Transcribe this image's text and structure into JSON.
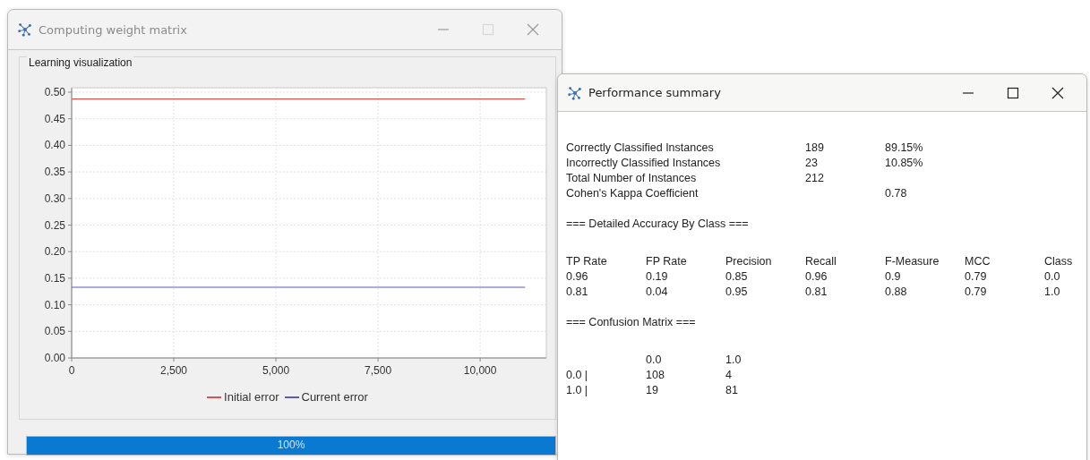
{
  "training_window": {
    "title": "Computing weight matrix",
    "active": false,
    "group_title": "Learning visualization",
    "chart_data": {
      "type": "line",
      "grid": true,
      "x": [
        0,
        11100
      ],
      "xlim": [
        0,
        11620
      ],
      "ylim": [
        0,
        0.5
      ],
      "xticks": [
        {
          "value": 0,
          "label": "0"
        },
        {
          "value": 2500,
          "label": "2,500"
        },
        {
          "value": 5000,
          "label": "5,000"
        },
        {
          "value": 7500,
          "label": "7,500"
        },
        {
          "value": 10000,
          "label": "10,000"
        }
      ],
      "yticks": [
        {
          "value": 0,
          "label": "0.00"
        },
        {
          "value": 0.05,
          "label": "0.05"
        },
        {
          "value": 0.1,
          "label": "0.10"
        },
        {
          "value": 0.15,
          "label": "0.15"
        },
        {
          "value": 0.2,
          "label": "0.20"
        },
        {
          "value": 0.25,
          "label": "0.25"
        },
        {
          "value": 0.3,
          "label": "0.30"
        },
        {
          "value": 0.35,
          "label": "0.35"
        },
        {
          "value": 0.4,
          "label": "0.40"
        },
        {
          "value": 0.45,
          "label": "0.45"
        },
        {
          "value": 0.5,
          "label": "0.50"
        }
      ],
      "series": [
        {
          "name": "Initial error",
          "color": "#d9534f",
          "values": [
            0.487,
            0.487
          ]
        },
        {
          "name": "Current error",
          "color": "#5b5bb5",
          "values": [
            0.133,
            0.133
          ]
        }
      ]
    },
    "progress": {
      "level": 1,
      "label": "100%"
    }
  },
  "summary_window": {
    "title": "Performance summary",
    "active": true,
    "stats": [
      {
        "label": "Correctly Classified Instances",
        "count": "189",
        "value": "89.15%"
      },
      {
        "label": "Incorrectly Classified Instances",
        "count": "23",
        "value": "10.85%"
      },
      {
        "label": "Total Number of Instances",
        "count": "212"
      },
      {
        "label": "Cohen's Kappa Coefficient",
        "value": "0.78"
      }
    ],
    "accuracy_heading": "=== Detailed Accuracy By Class ===",
    "accuracy_columns": [
      "TP Rate",
      "FP Rate",
      "Precision",
      "Recall",
      "F-Measure",
      "MCC",
      "Class"
    ],
    "accuracy_rows": [
      [
        "0.96",
        "0.19",
        "0.85",
        "0.96",
        "0.9",
        "0.79",
        "0.0"
      ],
      [
        "0.81",
        "0.04",
        "0.95",
        "0.81",
        "0.88",
        "0.79",
        "1.0"
      ]
    ],
    "confusion_heading": "=== Confusion Matrix ===",
    "confusion_columns": [
      "0.0",
      "1.0"
    ],
    "confusion_rows": [
      {
        "label": "0.0 |",
        "values": [
          "108",
          "4"
        ]
      },
      {
        "label": "1.0 |",
        "values": [
          "19",
          "81"
        ]
      }
    ]
  }
}
